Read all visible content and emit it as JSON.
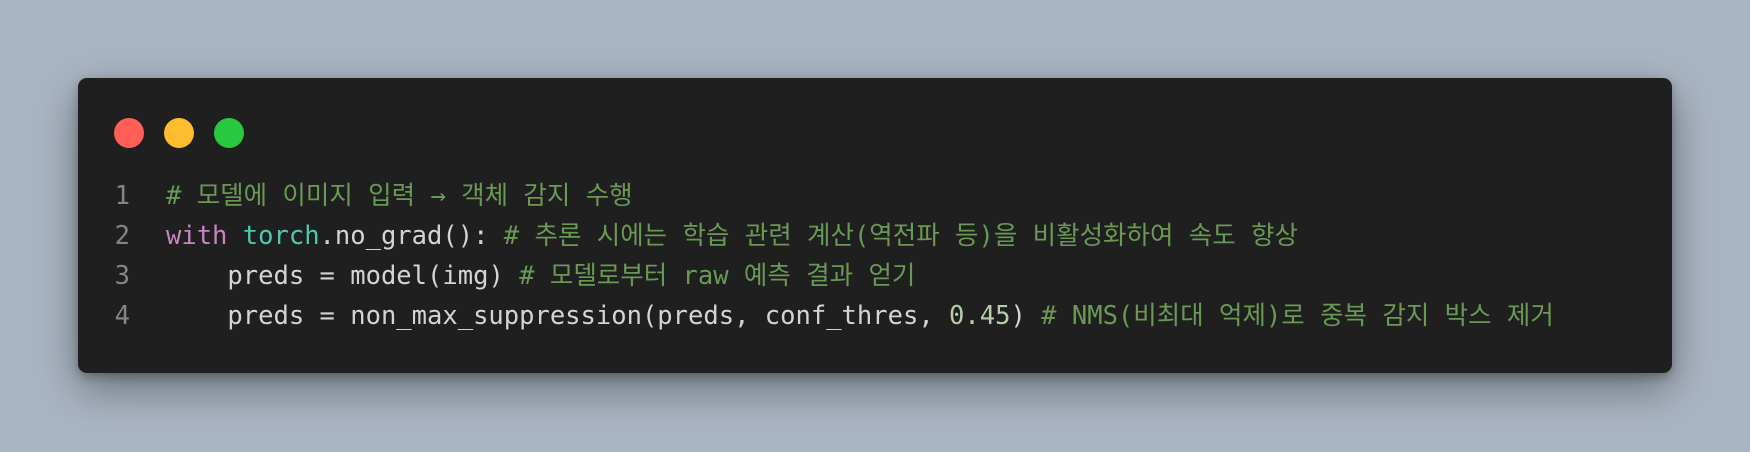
{
  "window": {
    "controls": [
      {
        "name": "close",
        "color": "#ff5f57"
      },
      {
        "name": "minimize",
        "color": "#febc2e"
      },
      {
        "name": "zoom",
        "color": "#28c840"
      }
    ]
  },
  "colors": {
    "background": "#aab5c3",
    "editor_background": "#1f1f1f",
    "keyword": "#c586c0",
    "module": "#4ec9b0",
    "variable": "#9cdcfe",
    "function": "#dcdcaa",
    "plain": "#d4d4d4",
    "number": "#b5cea8",
    "comment": "#6a9955",
    "line_number": "#858585"
  },
  "code": {
    "lines": [
      {
        "number": "1",
        "tokens": [
          {
            "type": "comment",
            "text": "# 모델에 이미지 입력 → 객체 감지 수행"
          }
        ]
      },
      {
        "number": "2",
        "tokens": [
          {
            "type": "keyword",
            "text": "with"
          },
          {
            "type": "plain",
            "text": " "
          },
          {
            "type": "module",
            "text": "torch"
          },
          {
            "type": "plain",
            "text": ".no_grad(): "
          },
          {
            "type": "comment",
            "text": "# 추론 시에는 학습 관련 계산(역전파 등)을 비활성화하여 속도 향상"
          }
        ]
      },
      {
        "number": "3",
        "tokens": [
          {
            "type": "plain",
            "text": "    "
          },
          {
            "type": "variable",
            "text": "preds"
          },
          {
            "type": "plain",
            "text": " = "
          },
          {
            "type": "variable",
            "text": "model"
          },
          {
            "type": "plain",
            "text": "("
          },
          {
            "type": "variable",
            "text": "img"
          },
          {
            "type": "plain",
            "text": ") "
          },
          {
            "type": "comment",
            "text": "# 모델로부터 raw 예측 결과 얻기"
          }
        ]
      },
      {
        "number": "4",
        "tokens": [
          {
            "type": "plain",
            "text": "    "
          },
          {
            "type": "variable",
            "text": "preds"
          },
          {
            "type": "plain",
            "text": " = non_max_suppression("
          },
          {
            "type": "variable",
            "text": "preds"
          },
          {
            "type": "plain",
            "text": ", "
          },
          {
            "type": "variable",
            "text": "conf_thres"
          },
          {
            "type": "plain",
            "text": ", "
          },
          {
            "type": "number",
            "text": "0.45"
          },
          {
            "type": "plain",
            "text": ") "
          },
          {
            "type": "comment",
            "text": "# NMS(비최대 억제)로 중복 감지 박스 제거"
          }
        ]
      }
    ]
  }
}
